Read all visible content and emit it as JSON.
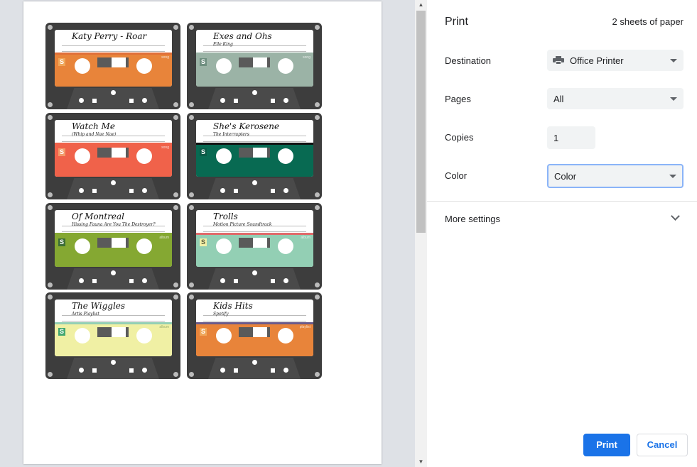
{
  "panel": {
    "title": "Print",
    "sheets": "2 sheets of paper",
    "destination": {
      "label": "Destination",
      "value": "Office Printer"
    },
    "pages": {
      "label": "Pages",
      "value": "All"
    },
    "copies": {
      "label": "Copies",
      "value": "1"
    },
    "color": {
      "label": "Color",
      "value": "Color"
    },
    "more_settings": "More settings",
    "print_button": "Print",
    "cancel_button": "Cancel"
  },
  "cassettes": [
    {
      "title": "Katy Perry - Roar",
      "subtitle": "",
      "tag": "song",
      "color": "#e8843a",
      "stripe": "#e06f38",
      "badge": "#f0a75a"
    },
    {
      "title": "Exes and Ohs",
      "subtitle": "Elle King",
      "tag": "song",
      "color": "#9bb3a6",
      "stripe": "#9bb3a6",
      "badge": "#6f8f80"
    },
    {
      "title": "Watch Me",
      "subtitle": "(Whip and Nae Nae)",
      "tag": "song",
      "color": "#f0624a",
      "stripe": "#f0624a",
      "badge": "#f39a6a"
    },
    {
      "title": "She's Kerosene",
      "subtitle": "The Interrupters",
      "tag": "",
      "color": "#086a52",
      "stripe": "#111111",
      "badge": "#0a5a46"
    },
    {
      "title": "Of Montreal",
      "subtitle": "Hissing Fauna Are You The Destroyer?",
      "tag": "album",
      "color": "#85a832",
      "stripe": "#85a832",
      "badge": "#3d6e36"
    },
    {
      "title": "Trolls",
      "subtitle": "Motion Picture Soundtrack",
      "tag": "album",
      "color": "#93cfb4",
      "stripe": "#e06a6a",
      "badge": "#f2f0a8"
    },
    {
      "title": "The Wiggles",
      "subtitle": "Artis Playlist",
      "tag": "album",
      "color": "#f0f0a4",
      "stripe": "#93cfb4",
      "badge": "#44a870"
    },
    {
      "title": "Kids Hits",
      "subtitle": "Spotify",
      "tag": "playlist",
      "color": "#e8843a",
      "stripe": "#6a5a8a",
      "badge": "#f0a75a"
    }
  ]
}
